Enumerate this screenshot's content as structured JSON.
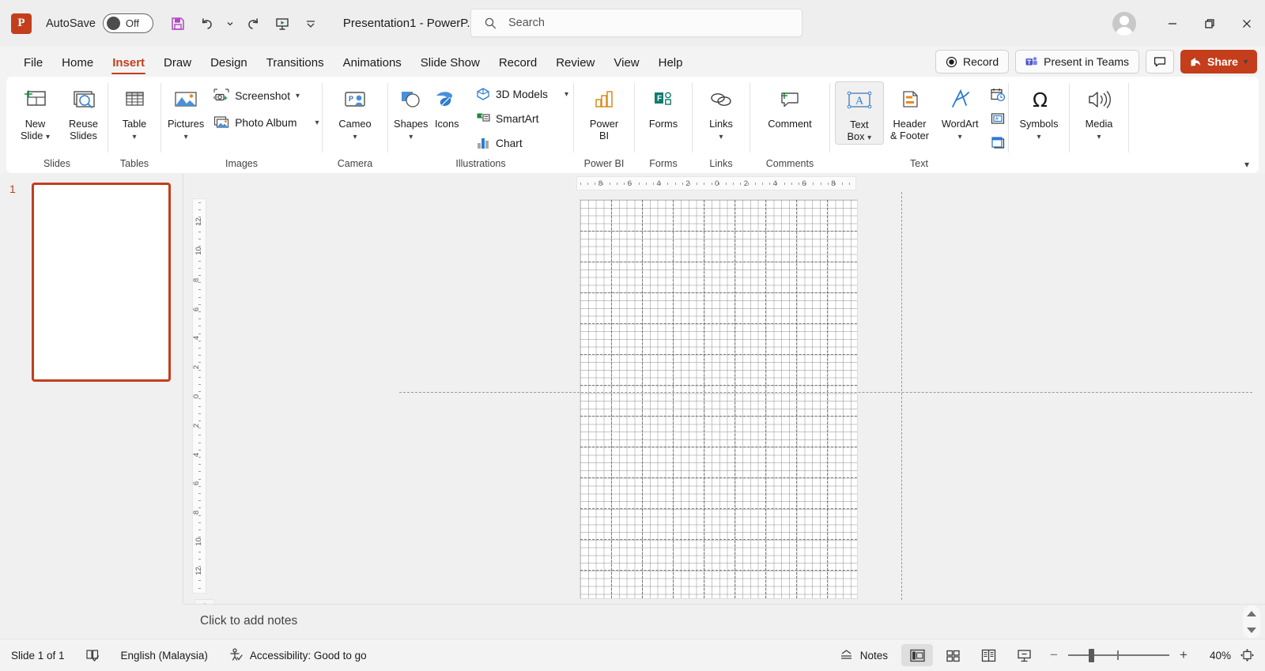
{
  "app": {
    "doc_title": "Presentation1  -  PowerP...",
    "autosave_label": "AutoSave",
    "autosave_state": "Off",
    "accent_color": "#c43e1c"
  },
  "quick_access": [
    {
      "name": "save-icon",
      "tooltip": "Save"
    },
    {
      "name": "undo-icon",
      "tooltip": "Undo"
    },
    {
      "name": "redo-icon",
      "tooltip": "Redo"
    },
    {
      "name": "start-presentation-icon",
      "tooltip": "Start From Beginning"
    },
    {
      "name": "customize-qat-icon",
      "tooltip": "Customize Quick Access Toolbar"
    }
  ],
  "search": {
    "placeholder": "Search",
    "icon": "search-icon"
  },
  "window_controls": {
    "minimize": "—",
    "restore": "❐",
    "close": "✕"
  },
  "tabs": [
    {
      "label": "File",
      "active": false
    },
    {
      "label": "Home",
      "active": false
    },
    {
      "label": "Insert",
      "active": true
    },
    {
      "label": "Draw",
      "active": false
    },
    {
      "label": "Design",
      "active": false
    },
    {
      "label": "Transitions",
      "active": false
    },
    {
      "label": "Animations",
      "active": false
    },
    {
      "label": "Slide Show",
      "active": false
    },
    {
      "label": "Record",
      "active": false
    },
    {
      "label": "Review",
      "active": false
    },
    {
      "label": "View",
      "active": false
    },
    {
      "label": "Help",
      "active": false
    }
  ],
  "tab_actions": {
    "record": "Record",
    "present_in_teams": "Present in Teams",
    "comments_icon": "comment-icon",
    "share": "Share"
  },
  "ribbon": {
    "groups": [
      {
        "label": "Slides",
        "buttons": [
          {
            "label": "New\nSlide",
            "icon": "new-slide-icon",
            "dropdown": true
          },
          {
            "label": "Reuse\nSlides",
            "icon": "reuse-slides-icon",
            "dropdown": false
          }
        ]
      },
      {
        "label": "Tables",
        "buttons": [
          {
            "label": "Table",
            "icon": "table-icon",
            "dropdown": true
          }
        ]
      },
      {
        "label": "Images",
        "buttons": [
          {
            "label": "Pictures",
            "icon": "pictures-icon",
            "dropdown": true
          }
        ],
        "small_buttons": [
          {
            "label": "Screenshot",
            "icon": "screenshot-icon",
            "dropdown": true
          },
          {
            "label": "Photo Album",
            "icon": "photo-album-icon",
            "dropdown": true
          }
        ]
      },
      {
        "label": "Camera",
        "buttons": [
          {
            "label": "Cameo",
            "icon": "cameo-icon",
            "dropdown": true
          }
        ]
      },
      {
        "label": "Illustrations",
        "buttons": [
          {
            "label": "Shapes",
            "icon": "shapes-icon",
            "dropdown": true
          },
          {
            "label": "Icons",
            "icon": "icons-icon",
            "dropdown": false
          }
        ],
        "small_buttons": [
          {
            "label": "3D Models",
            "icon": "3d-models-icon",
            "dropdown": true
          },
          {
            "label": "SmartArt",
            "icon": "smartart-icon",
            "dropdown": false
          },
          {
            "label": "Chart",
            "icon": "chart-icon",
            "dropdown": false
          }
        ]
      },
      {
        "label": "Power BI",
        "buttons": [
          {
            "label": "Power\nBI",
            "icon": "power-bi-icon",
            "dropdown": false
          }
        ]
      },
      {
        "label": "Forms",
        "buttons": [
          {
            "label": "Forms",
            "icon": "forms-icon",
            "dropdown": false
          }
        ]
      },
      {
        "label": "",
        "buttons": [
          {
            "label": "Links",
            "icon": "links-icon",
            "dropdown": true
          }
        ]
      },
      {
        "label": "Comments",
        "buttons": [
          {
            "label": "Comment",
            "icon": "comment-new-icon",
            "dropdown": false
          }
        ]
      },
      {
        "label": "Text",
        "buttons": [
          {
            "label": "Text\nBox",
            "icon": "text-box-icon",
            "dropdown": true,
            "selected": true
          },
          {
            "label": "Header\n& Footer",
            "icon": "header-footer-icon",
            "dropdown": false
          },
          {
            "label": "WordArt",
            "icon": "wordart-icon",
            "dropdown": true
          }
        ],
        "tiny_buttons": [
          {
            "icon": "date-time-icon"
          },
          {
            "icon": "slide-number-icon"
          },
          {
            "icon": "object-icon"
          }
        ]
      },
      {
        "label": "",
        "buttons": [
          {
            "label": "Symbols",
            "icon": "symbols-icon",
            "dropdown": true
          }
        ]
      },
      {
        "label": "",
        "buttons": [
          {
            "label": "Media",
            "icon": "media-icon",
            "dropdown": true
          }
        ]
      }
    ],
    "forms_group_label": "Forms",
    "links_group_label": "Links",
    "collapse_icon": "chevron-down-icon"
  },
  "slide_panel": {
    "slide_number": "1"
  },
  "canvas": {
    "h_ruler_ticks": [
      "8",
      "6",
      "4",
      "2",
      "0",
      "2",
      "4",
      "6",
      "8"
    ],
    "v_ruler_ticks": [
      "12",
      "10",
      "8",
      "6",
      "4",
      "2",
      "0",
      "2",
      "4",
      "6",
      "8",
      "10",
      "12"
    ],
    "gridlines_visible": true,
    "guides_visible": true
  },
  "notes": {
    "placeholder": "Click to add notes",
    "toggle_icon": "notes-collapse-icon",
    "scroll_up_icon": "scroll-up-icon",
    "scroll_down_icon": "scroll-down-icon"
  },
  "status_bar": {
    "slide_count": "Slide 1 of 1",
    "spellcheck_icon": "spellcheck-icon",
    "language": "English (Malaysia)",
    "accessibility_icon": "accessibility-icon",
    "accessibility": "Accessibility: Good to go",
    "notes_label": "Notes",
    "notes_icon": "notes-icon",
    "views": [
      {
        "name": "normal-view",
        "icon": "normal-view-icon",
        "active": true
      },
      {
        "name": "slide-sorter-view",
        "icon": "slide-sorter-icon",
        "active": false
      },
      {
        "name": "reading-view",
        "icon": "reading-view-icon",
        "active": false
      },
      {
        "name": "slide-show-view",
        "icon": "slide-show-icon",
        "active": false
      }
    ],
    "zoom_out": "−",
    "zoom_in": "+",
    "zoom_level": "40%",
    "fit_icon": "fit-to-window-icon"
  }
}
